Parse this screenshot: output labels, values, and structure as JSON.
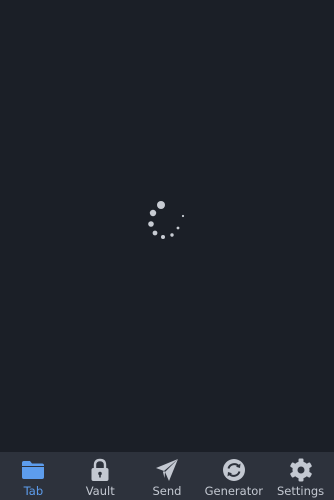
{
  "colors": {
    "background": "#1b1f27",
    "tabbar": "#2d323c",
    "active": "#5d9ded",
    "inactive": "#c3c8d1",
    "spinner": "#c7cbd2"
  },
  "main": {
    "loading_indicator": "spinner-icon"
  },
  "tabbar": {
    "tabs": [
      {
        "label": "Tab",
        "icon": "folder-icon",
        "active": true
      },
      {
        "label": "Vault",
        "icon": "lock-icon",
        "active": false
      },
      {
        "label": "Send",
        "icon": "paper-plane-icon",
        "active": false
      },
      {
        "label": "Generator",
        "icon": "refresh-icon",
        "active": false
      },
      {
        "label": "Settings",
        "icon": "gear-icon",
        "active": false
      }
    ]
  }
}
